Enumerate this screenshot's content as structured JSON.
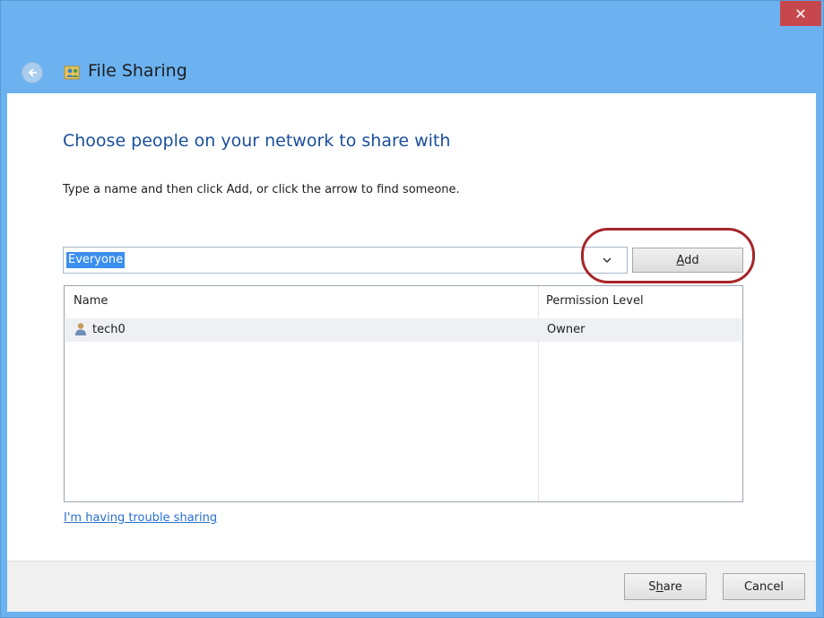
{
  "window": {
    "title": "File Sharing",
    "close_label": "✕"
  },
  "main": {
    "heading": "Choose people on your network to share with",
    "instruction": "Type a name and then click Add, or click the arrow to find someone.",
    "name_input_value": "Everyone",
    "add_label": "Add",
    "add_mnemonic_prefix": "",
    "add_mnemonic": "A",
    "add_suffix": "dd"
  },
  "list": {
    "columns": [
      "Name",
      "Permission Level"
    ],
    "rows": [
      {
        "name": "tech0",
        "permission": "Owner"
      }
    ]
  },
  "links": {
    "trouble": "I'm having trouble sharing"
  },
  "footer": {
    "share_pre": "S",
    "share_mnemonic": "h",
    "share_post": "are",
    "cancel_label": "Cancel"
  },
  "colors": {
    "titlebar": "#6cb2f0",
    "heading": "#1a4e9c",
    "link": "#2a6fd0",
    "highlight_ring": "#a5262a",
    "close_button": "#c7484c"
  },
  "icons": {
    "back": "back-arrow-icon",
    "app": "file-sharing-icon",
    "user": "user-icon",
    "dropdown": "chevron-down-icon"
  }
}
